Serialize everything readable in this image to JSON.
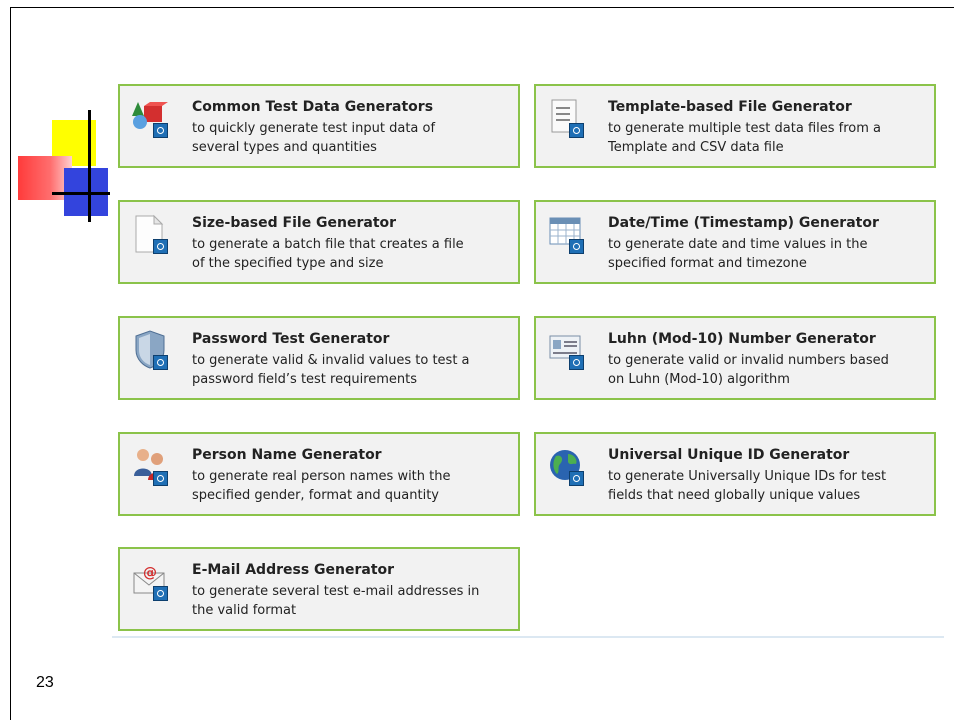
{
  "cards": [
    {
      "title": "Common Test Data Generators",
      "line1": "to quickly generate test input data of",
      "line2": "several types and quantities",
      "icon": "shapes-icon"
    },
    {
      "title": "Template-based File Generator",
      "line1": "to generate multiple test data files from a",
      "line2": "Template and CSV data file",
      "icon": "document-icon"
    },
    {
      "title": "Size-based File Generator",
      "line1": "to generate a batch file that creates a file",
      "line2": "of the specified type and size",
      "icon": "blank-file-icon"
    },
    {
      "title": "Date/Time (Timestamp) Generator",
      "line1": "to generate date and time values in the",
      "line2": "specified format and timezone",
      "icon": "calendar-icon"
    },
    {
      "title": "Password Test Generator",
      "line1": "to generate valid & invalid values to test a",
      "line2": "password field’s test requirements",
      "icon": "shield-icon"
    },
    {
      "title": "Luhn (Mod-10) Number Generator",
      "line1": "to generate valid or invalid numbers based",
      "line2": "on Luhn (Mod-10) algorithm",
      "icon": "id-card-icon"
    },
    {
      "title": "Person Name Generator",
      "line1": "to generate real person names with the",
      "line2": "specified gender, format and quantity",
      "icon": "people-icon"
    },
    {
      "title": "Universal Unique ID Generator",
      "line1": "to generate Universally Unique IDs for test",
      "line2": "fields that need globally unique values",
      "icon": "globe-icon"
    },
    {
      "title": "E-Mail Address Generator",
      "line1": "to generate several test e-mail addresses in",
      "line2": "the valid format",
      "icon": "email-icon"
    }
  ],
  "page_number": "23",
  "colors": {
    "card_border": "#8bc34a",
    "card_bg": "#f2f2f2",
    "gear": "#1f6fb5"
  }
}
